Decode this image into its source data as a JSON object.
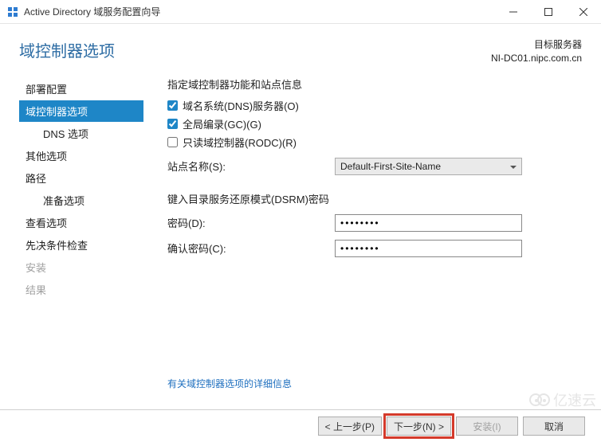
{
  "window": {
    "title": "Active Directory 域服务配置向导"
  },
  "header": {
    "page_title": "域控制器选项",
    "target_label": "目标服务器",
    "target_server": "NI-DC01.nipc.com.cn"
  },
  "sidebar": {
    "items": [
      {
        "label": "部署配置",
        "sub": false,
        "selected": false,
        "disabled": false
      },
      {
        "label": "域控制器选项",
        "sub": false,
        "selected": true,
        "disabled": false
      },
      {
        "label": "DNS 选项",
        "sub": true,
        "selected": false,
        "disabled": false
      },
      {
        "label": "其他选项",
        "sub": false,
        "selected": false,
        "disabled": false
      },
      {
        "label": "路径",
        "sub": false,
        "selected": false,
        "disabled": false
      },
      {
        "label": "准备选项",
        "sub": true,
        "selected": false,
        "disabled": false
      },
      {
        "label": "查看选项",
        "sub": false,
        "selected": false,
        "disabled": false
      },
      {
        "label": "先决条件检查",
        "sub": false,
        "selected": false,
        "disabled": false
      },
      {
        "label": "安装",
        "sub": false,
        "selected": false,
        "disabled": true
      },
      {
        "label": "结果",
        "sub": false,
        "selected": false,
        "disabled": true
      }
    ]
  },
  "main": {
    "caps_label": "指定域控制器功能和站点信息",
    "chk_dns": "域名系统(DNS)服务器(O)",
    "chk_gc": "全局编录(GC)(G)",
    "chk_rodc": "只读域控制器(RODC)(R)",
    "chk_dns_checked": true,
    "chk_gc_checked": true,
    "chk_rodc_checked": false,
    "site_label": "站点名称(S):",
    "site_value": "Default-First-Site-Name",
    "dsrm_label": "键入目录服务还原模式(DSRM)密码",
    "pwd_label": "密码(D):",
    "pwd_value": "••••••••",
    "confirm_label": "确认密码(C):",
    "confirm_value": "••••••••",
    "link_text": "有关域控制器选项的详细信息"
  },
  "footer": {
    "prev": "< 上一步(P)",
    "next": "下一步(N) >",
    "install": "安装(I)",
    "cancel": "取消"
  },
  "watermark": "亿速云"
}
